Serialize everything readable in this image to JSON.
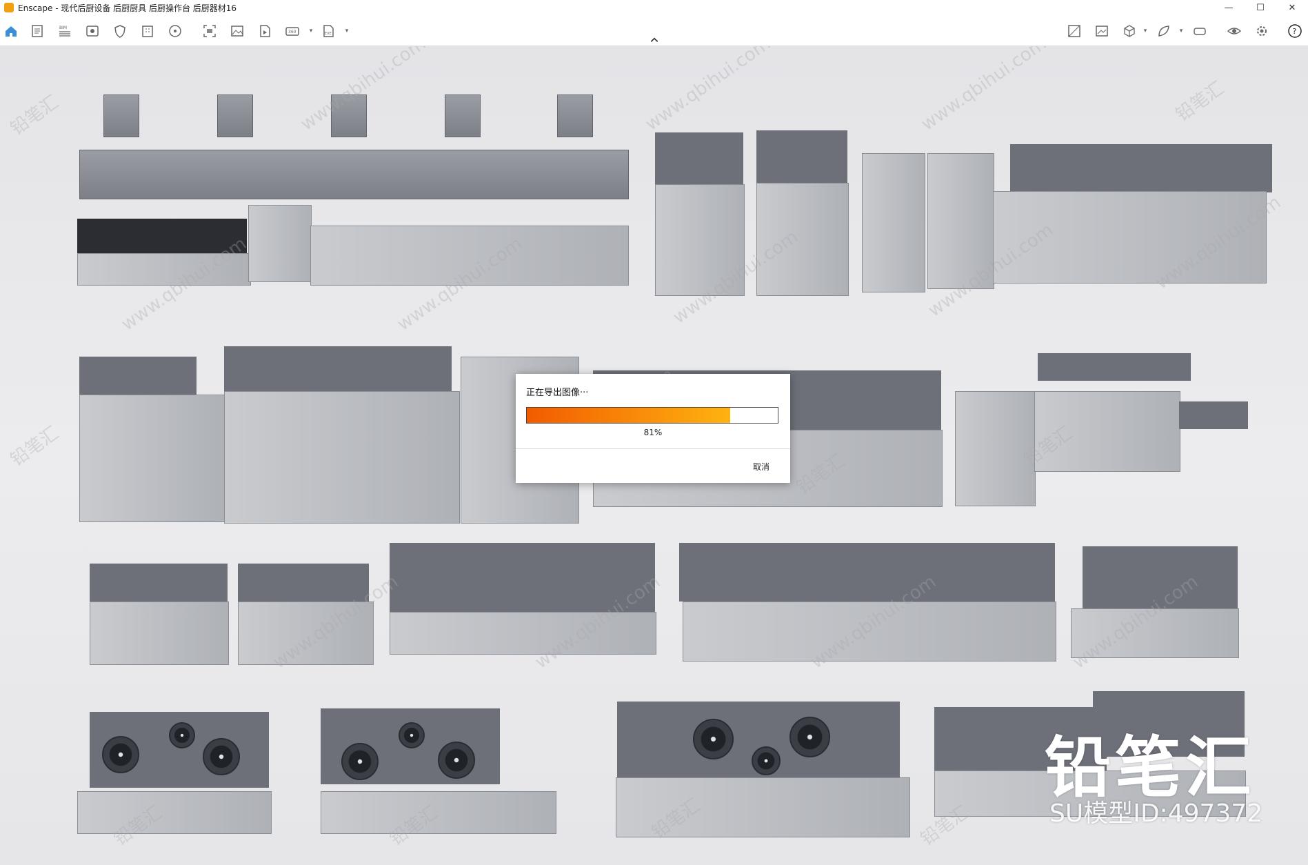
{
  "window": {
    "title": "Enscape - 现代后厨设备 后厨厨具 后厨操作台 后厨器材16",
    "minimize": "—",
    "maximize": "☐",
    "close": "✕"
  },
  "toolbar": {
    "left_icons": [
      "home-icon",
      "document-icon",
      "bim-icon",
      "view-icon",
      "shield-icon",
      "building-icon",
      "atom-icon",
      "capture-icon",
      "image-icon",
      "video-icon",
      "panorama-360-icon",
      "exe-export-icon"
    ],
    "right_icons": [
      "map-icon",
      "screenshot-icon",
      "cube-icon",
      "leaf-icon",
      "vr-headset-icon",
      "eye-icon",
      "settings-icon",
      "help-icon"
    ],
    "bim_text": "BIM",
    "pano_text": "360",
    "exe_text": "EXE",
    "help_text": "?"
  },
  "export_dialog": {
    "label": "正在导出图像···",
    "progress": 0.81,
    "progress_text": "81%",
    "cancel_label": "取消",
    "fill_start": "#f25b00",
    "fill_end": "#ffb310"
  },
  "watermark": {
    "logo_text": "铅笔汇",
    "id_text": "SU模型ID:497372",
    "repeat_text_cn": "铅笔汇",
    "repeat_text_url": "www.qbihui.com"
  }
}
